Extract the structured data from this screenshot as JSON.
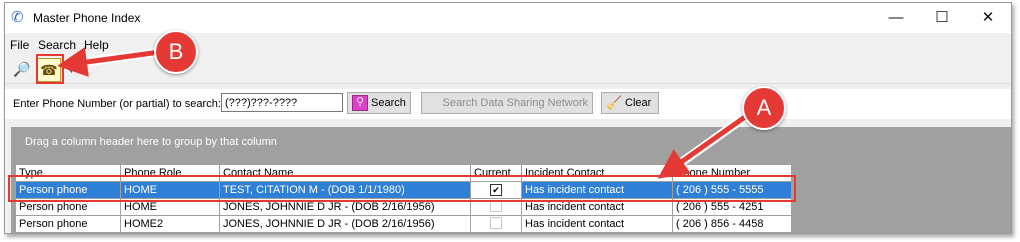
{
  "window": {
    "title": "Master Phone Index",
    "controls": {
      "minimize": "—",
      "maximize": "☐",
      "close": "✕"
    }
  },
  "menu": {
    "items": [
      "File",
      "Search",
      "Help"
    ]
  },
  "toolbar": {
    "buttons": [
      {
        "icon": "magnifier-icon",
        "glyph": "🔎"
      },
      {
        "icon": "phone-search-icon",
        "glyph": "☎",
        "active": true
      },
      {
        "icon": "back-arrow-icon",
        "glyph": "⬅"
      }
    ]
  },
  "search": {
    "label": "Enter Phone Number (or partial) to search:",
    "input_value": "(???)???-????",
    "search_button": "Search",
    "data_sharing_button": "Search Data Sharing Network",
    "clear_button": "Clear"
  },
  "grid": {
    "group_hint": "Drag a column header here to group by that column",
    "columns": [
      "Type",
      "Phone Role",
      "Contact Name",
      "Current",
      "Incident Contact",
      "Phone Number"
    ],
    "rows": [
      {
        "type": "Person phone",
        "role": "HOME",
        "name": "TEST, CITATION M - (DOB 1/1/1980)",
        "current": true,
        "incident": "Has incident contact",
        "phone": "( 206 ) 555 - 5555",
        "selected": true
      },
      {
        "type": "Person phone",
        "role": "HOME",
        "name": "JONES, JOHNNIE D JR - (DOB 2/16/1956)",
        "current": false,
        "incident": "Has incident contact",
        "phone": "( 206 ) 555 - 4251",
        "selected": false
      },
      {
        "type": "Person phone",
        "role": "HOME2",
        "name": "JONES, JOHNNIE D JR - (DOB 2/16/1956)",
        "current": false,
        "incident": "Has incident contact",
        "phone": "( 206 ) 856 - 4458",
        "selected": false
      }
    ]
  },
  "annotations": {
    "callout_a": "A",
    "callout_b": "B",
    "color": "#e53935"
  },
  "colors": {
    "selection": "#2f7fd6",
    "group_bar": "#a0a0a0"
  }
}
